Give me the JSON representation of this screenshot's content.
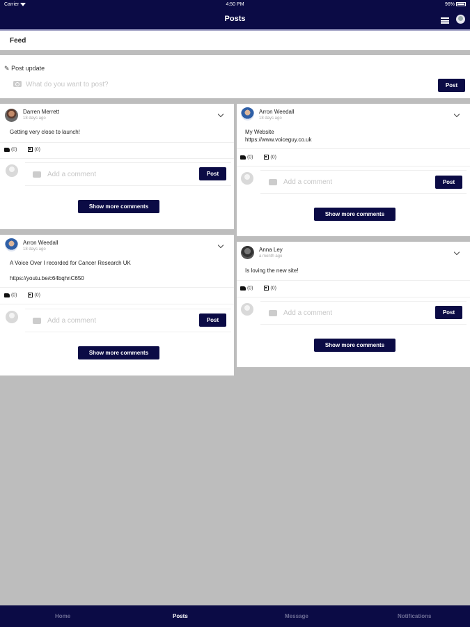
{
  "status_bar": {
    "carrier": "Carrier",
    "time": "4:50 PM",
    "battery": "96%"
  },
  "header": {
    "title": "Posts"
  },
  "feed": {
    "label": "Feed"
  },
  "post_update": {
    "label": "Post update",
    "placeholder": "What do you want to post?",
    "post_label": "Post"
  },
  "posts": [
    {
      "author": "Darren Merrett",
      "time": "18 days ago",
      "lines": [
        "Getting very close to launch!"
      ],
      "likes": "(0)",
      "shares": "(0)",
      "comment_placeholder": "Add a comment",
      "post_label": "Post",
      "more_label": "Show more comments"
    },
    {
      "author": "Arron Weedall",
      "time": "18 days ago",
      "lines": [
        "A Voice Over I recorded for Cancer Research UK",
        "https://youtu.be/c64bqhnC650"
      ],
      "likes": "(0)",
      "shares": "(0)",
      "comment_placeholder": "Add a comment",
      "post_label": "Post",
      "more_label": "Show more comments"
    },
    {
      "author": "Arron Weedall",
      "time": "18 days ago",
      "lines": [
        "My Website",
        "https://www.voiceguy.co.uk"
      ],
      "likes": "(0)",
      "shares": "(0)",
      "comment_placeholder": "Add a comment",
      "post_label": "Post",
      "more_label": "Show more comments"
    },
    {
      "author": "Anna Ley",
      "time": "a month ago",
      "lines": [
        "Is loving the new site!"
      ],
      "likes": "(0)",
      "shares": "(0)",
      "comment_placeholder": "Add a comment",
      "post_label": "Post",
      "more_label": "Show more comments"
    }
  ],
  "nav": {
    "items": [
      "Home",
      "Posts",
      "Message",
      "Notifications"
    ],
    "active": "Posts"
  }
}
